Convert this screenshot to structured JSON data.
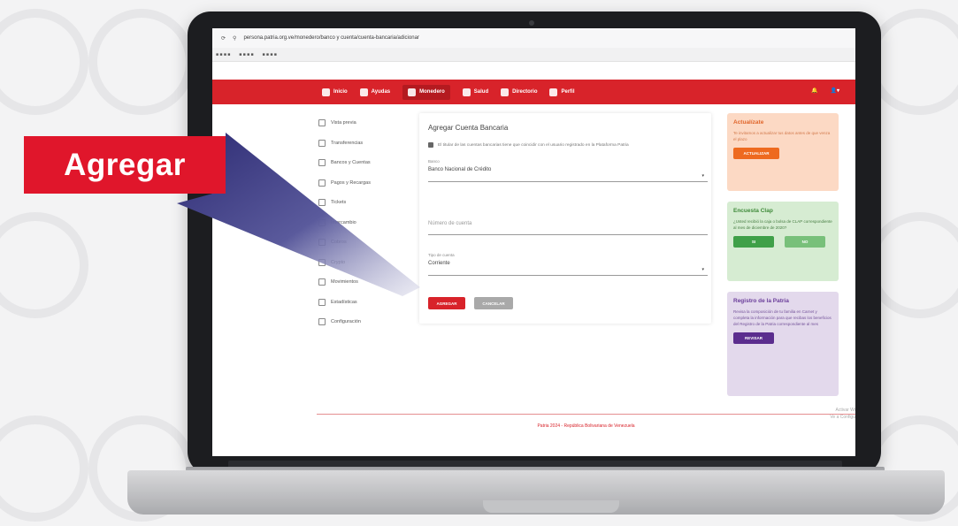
{
  "callout": {
    "label": "Agregar"
  },
  "browser": {
    "url": "persona.patria.org.ve/monedero/banco y cuenta/cuenta-bancaria/adicionar"
  },
  "nav": {
    "items": [
      {
        "label": "Inicio",
        "icon": "home-icon"
      },
      {
        "label": "Ayudas",
        "icon": "gear-icon"
      },
      {
        "label": "Monedero",
        "icon": "wallet-icon"
      },
      {
        "label": "Salud",
        "icon": "health-icon"
      },
      {
        "label": "Directorio",
        "icon": "directory-icon"
      },
      {
        "label": "Perfil",
        "icon": "user-icon"
      }
    ],
    "active": "Monedero"
  },
  "sidebar": {
    "items": [
      {
        "label": "Vista previa",
        "icon": "eye-icon"
      },
      {
        "label": "Transferencias",
        "icon": "transfer-icon"
      },
      {
        "label": "Bancos y Cuentas",
        "icon": "bank-icon"
      },
      {
        "label": "Pagos y Recargas",
        "icon": "payment-icon"
      },
      {
        "label": "Tickets",
        "icon": "ticket-icon"
      },
      {
        "label": "Intercambio",
        "icon": "exchange-icon"
      },
      {
        "label": "Cobros",
        "icon": "cobro-icon"
      },
      {
        "label": "Crypto",
        "icon": "crypto-icon"
      },
      {
        "label": "Movimientos",
        "icon": "list-icon"
      },
      {
        "label": "Estadísticas",
        "icon": "chart-icon"
      },
      {
        "label": "Configuración",
        "icon": "settings-icon"
      }
    ]
  },
  "form": {
    "title": "Agregar Cuenta Bancaria",
    "checkbox_text": "El titular de las cuentas bancarias tiene que coincidir con el usuario registrado en la Plataforma Patria",
    "bank_label": "Banco",
    "bank_value": "Banco Nacional de Crédito",
    "account_placeholder": "Número de cuenta",
    "type_label": "Tipo de cuenta",
    "type_value": "Corriente",
    "add_button": "AGREGAR",
    "cancel_button": "CANCELAR"
  },
  "panels": [
    {
      "title": "Actualízate",
      "body": "Te invitamos a actualizar tus datos antes de que venza el plazo",
      "button": "ACTUALIZAR"
    },
    {
      "title": "Encuesta Clap",
      "body": "¿Usted recibió la caja o bolsa de CLAP correspondiente al mes de diciembre de 2020?",
      "buttons": [
        "SI",
        "NO"
      ]
    },
    {
      "title": "Registro de la Patria",
      "body": "Revisa la composición de tu familia en Carnet y completa la información para que recibas los beneficios del Registro de la Patria correspondiente al mes",
      "button": "REVISAR"
    }
  ],
  "footer": {
    "text": "Patria 2024 - República Bolivariana de Venezuela"
  },
  "watermark": {
    "line1": "Activar Wi",
    "line2": "Ve a Configu"
  },
  "colors": {
    "brand": "#d8232a",
    "panel1": "#fcd9c4",
    "panel2": "#d6ecd2",
    "panel3": "#e3d9ec"
  }
}
